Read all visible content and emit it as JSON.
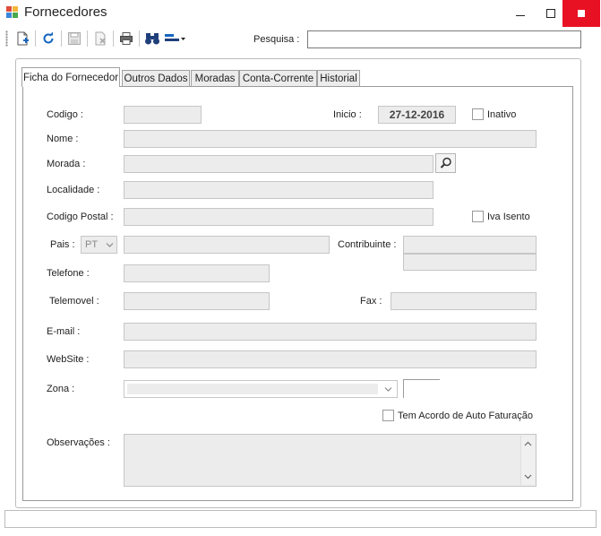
{
  "window": {
    "title": "Fornecedores"
  },
  "toolbar": {
    "search_label": "Pesquisa :",
    "search_value": ""
  },
  "tabs": [
    {
      "label": "Ficha do Fornecedor",
      "active": true
    },
    {
      "label": "Outros Dados",
      "active": false
    },
    {
      "label": "Moradas",
      "active": false
    },
    {
      "label": "Conta-Corrente",
      "active": false
    },
    {
      "label": "Historial",
      "active": false
    }
  ],
  "form": {
    "codigo_label": "Codigo :",
    "inicio_label": "Inicio :",
    "inicio_value": "27-12-2016",
    "inativo_label": "Inativo",
    "nome_label": "Nome :",
    "morada_label": "Morada :",
    "localidade_label": "Localidade :",
    "codigo_postal_label": "Codigo Postal :",
    "iva_isento_label": "Iva Isento",
    "pais_label": "Pais :",
    "pais_value": "PT",
    "contribuinte_label": "Contribuinte :",
    "telefone_label": "Telefone :",
    "telemovel_label": "Telemovel :",
    "fax_label": "Fax :",
    "email_label": "E-mail :",
    "website_label": "WebSite :",
    "zona_label": "Zona :",
    "auto_faturacao_label": "Tem Acordo de Auto Faturação",
    "observacoes_label": "Observações :"
  },
  "colors": {
    "close_button": "#e81123",
    "field_bg": "#ececec",
    "accent_blue": "#1565c0"
  }
}
